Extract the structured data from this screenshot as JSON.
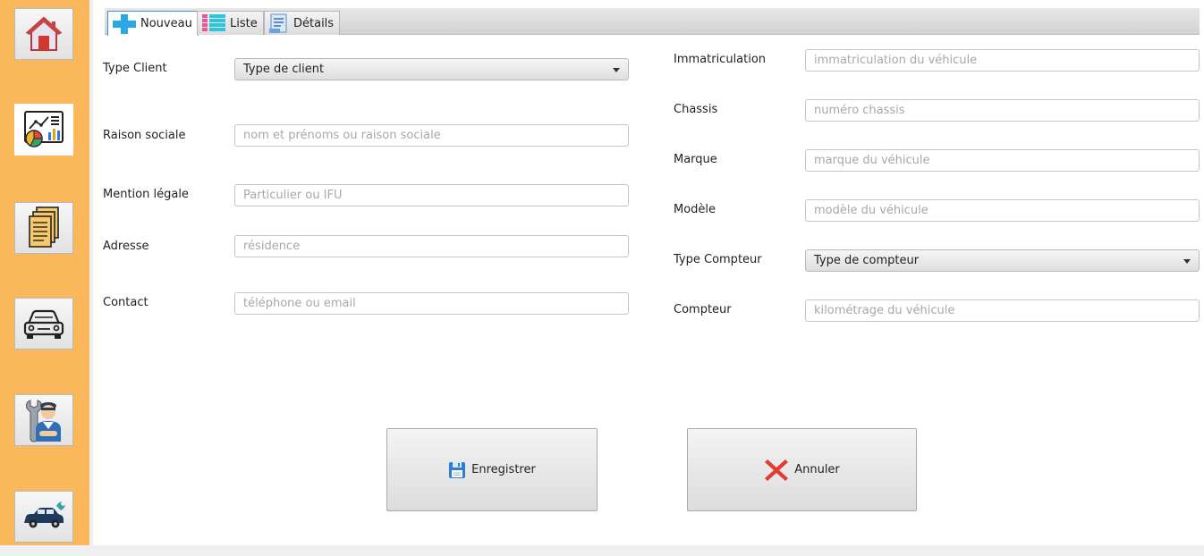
{
  "sidebar": {
    "items": [
      {
        "icon": "home-icon"
      },
      {
        "icon": "dashboard-chart-icon",
        "active": true
      },
      {
        "icon": "documents-icon"
      },
      {
        "icon": "car-icon"
      },
      {
        "icon": "mechanic-icon"
      },
      {
        "icon": "car-repair-icon"
      }
    ]
  },
  "tabs": [
    {
      "label": "Nouveau",
      "icon": "plus-icon",
      "active": true
    },
    {
      "label": "Liste",
      "icon": "list-icon"
    },
    {
      "label": "Détails",
      "icon": "details-icon"
    }
  ],
  "client_form": {
    "type_client": {
      "label": "Type Client",
      "selected": "Type de client"
    },
    "raison_sociale": {
      "label": "Raison sociale",
      "placeholder": "nom et prénoms ou raison sociale"
    },
    "mention_legale": {
      "label": "Mention légale",
      "placeholder": "Particulier ou IFU"
    },
    "adresse": {
      "label": "Adresse",
      "placeholder": "résidence"
    },
    "contact": {
      "label": "Contact",
      "placeholder": "téléphone ou email"
    }
  },
  "vehicle_form": {
    "immatriculation": {
      "label": "Immatriculation",
      "placeholder": "immatriculation du véhicule"
    },
    "chassis": {
      "label": "Chassis",
      "placeholder": "numéro chassis"
    },
    "marque": {
      "label": "Marque",
      "placeholder": "marque du véhicule"
    },
    "modele": {
      "label": "Modèle",
      "placeholder": "modèle du véhicule"
    },
    "type_compteur": {
      "label": "Type Compteur",
      "selected": "Type de compteur"
    },
    "compteur": {
      "label": "Compteur",
      "placeholder": "kilométrage du véhicule"
    }
  },
  "actions": {
    "save_label": "Enregistrer",
    "cancel_label": "Annuler"
  },
  "colors": {
    "sidebar_bg": "#fbb75c",
    "tab_active_border": "#3d8fd8",
    "cancel_icon": "#e53935",
    "save_icon": "#2f7fd0"
  }
}
